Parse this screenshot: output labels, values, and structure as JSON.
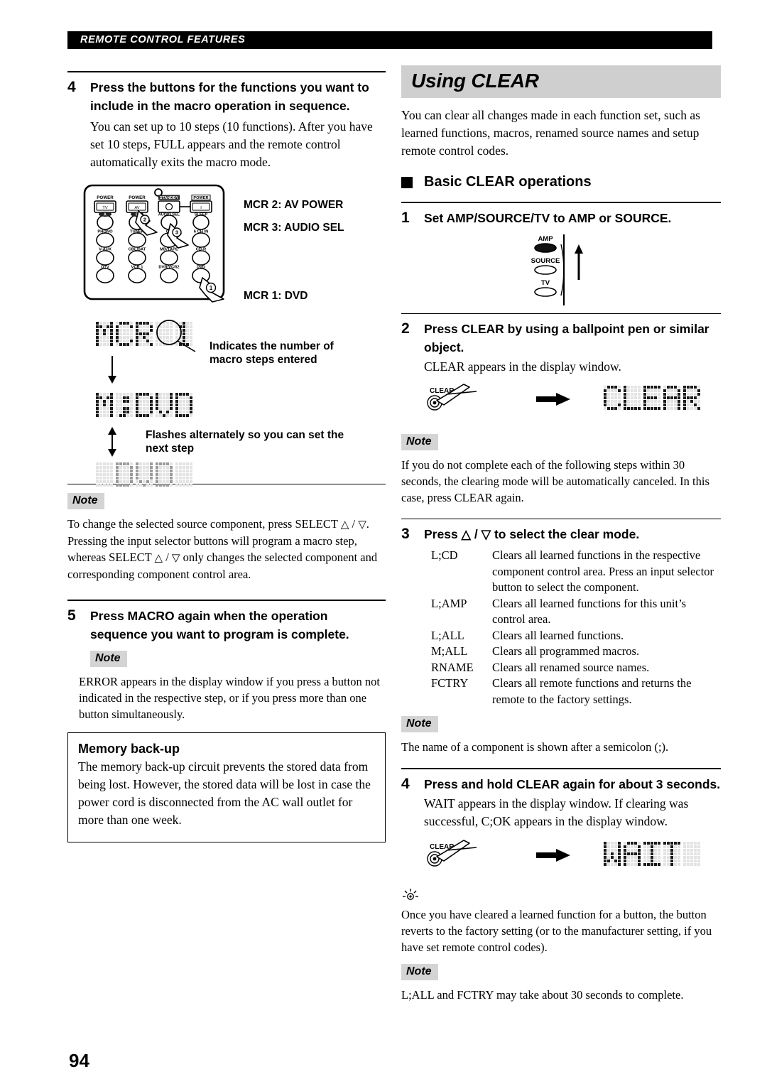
{
  "running_head": "REMOTE CONTROL FEATURES",
  "page_number": "94",
  "left_column": {
    "step4": {
      "number": "4",
      "heading": "Press the buttons for the functions you want to include in the macro operation in sequence.",
      "body": "You can set up to 10 steps (10 functions). After you have set 10 steps, FULL appears and the remote control automatically exits the macro mode."
    },
    "remote_diagram": {
      "buttons": [
        {
          "label": "POWER",
          "sub": "TV"
        },
        {
          "label": "POWER",
          "sub": "AV"
        },
        {
          "label": "STANDBY",
          "sub": "⏻"
        },
        {
          "label": "POWER",
          "sub": "I"
        },
        {
          "label": "A",
          "sub": ""
        },
        {
          "label": "B",
          "sub": ""
        },
        {
          "label": "AUDIO SEL",
          "sub": ""
        },
        {
          "label": "SLEEP",
          "sub": ""
        },
        {
          "label": "PHONO",
          "sub": ""
        },
        {
          "label": "TUNER",
          "sub": ""
        },
        {
          "label": "CD",
          "sub": ""
        },
        {
          "label": "6 CH IN",
          "sub": ""
        },
        {
          "label": "V-AUX",
          "sub": ""
        },
        {
          "label": "CBL/SAT",
          "sub": ""
        },
        {
          "label": "MD/TAPE",
          "sub": ""
        },
        {
          "label": "CD-R",
          "sub": ""
        },
        {
          "label": "DTV",
          "sub": ""
        },
        {
          "label": "VCR 1",
          "sub": ""
        },
        {
          "label": "DVR/VCR2",
          "sub": ""
        },
        {
          "label": "DVD",
          "sub": ""
        }
      ],
      "press_markers": [
        "1",
        "2",
        "3"
      ],
      "mcr_labels": [
        "MCR 2: AV POWER",
        "MCR 3: AUDIO SEL",
        "MCR 1: DVD"
      ]
    },
    "lcd_sequence": {
      "display1": "MCR 1",
      "display1_callout": "Indicates the number of macro steps entered",
      "display2": "M;DVD",
      "display2_callout": "Flashes alternately so you can set the next step",
      "display3": "DVD"
    },
    "note1": {
      "tag": "Note",
      "text_parts": [
        "To change the selected source component, press SELECT ",
        "△",
        " / ",
        "▽",
        ". Pressing the input selector buttons will program a macro step, whereas SELECT ",
        "△",
        " / ",
        "▽",
        " only changes the selected component and corresponding component control area."
      ],
      "text": "To change the selected source component, press SELECT △ / ▽. Pressing the input selector buttons will program a macro step, whereas SELECT △ / ▽ only changes the selected component and corresponding component control area."
    },
    "step5": {
      "number": "5",
      "heading": "Press MACRO again when the operation sequence you want to program is complete."
    },
    "note2": {
      "tag": "Note",
      "text": "ERROR appears in the display window if you press a button not indicated in the respective step, or if you press more than one button simultaneously."
    },
    "memory_box": {
      "title": "Memory back-up",
      "text": "The memory back-up circuit prevents the stored data from being lost. However, the stored data will be lost in case the power cord is disconnected from the AC wall outlet for more than one week."
    }
  },
  "right_column": {
    "banner_title": "Using CLEAR",
    "intro": "You can clear all changes made in each function set, such as learned functions, macros, renamed source names and setup remote control codes.",
    "subsection": "Basic CLEAR operations",
    "step1": {
      "number": "1",
      "heading": "Set AMP/SOURCE/TV to AMP or SOURCE."
    },
    "switch_diagram": {
      "positions": [
        "AMP",
        "SOURCE",
        "TV"
      ],
      "selected": "AMP"
    },
    "step2": {
      "number": "2",
      "heading": "Press CLEAR by using a ballpoint pen or similar object.",
      "body": "CLEAR appears in the display window."
    },
    "clear_diagram_1": {
      "button_label": "CLEAR",
      "display": "CLEAR"
    },
    "note1": {
      "tag": "Note",
      "text": "If you do not complete each of the following steps within 30 seconds, the clearing mode will be automatically canceled. In this case, press CLEAR again."
    },
    "step3": {
      "number": "3",
      "heading_pre": "Press ",
      "heading_up": "△",
      "heading_mid": " / ",
      "heading_down": "▽",
      "heading_post": " to select the clear mode.",
      "modes": [
        {
          "name": "L;CD",
          "desc": "Clears all learned functions in the respective component control area. Press an input selector button to select the component."
        },
        {
          "name": "L;AMP",
          "desc": "Clears all learned functions for this unit’s control area."
        },
        {
          "name": "L;ALL",
          "desc": "Clears all learned functions."
        },
        {
          "name": "M;ALL",
          "desc": "Clears all programmed macros."
        },
        {
          "name": "RNAME",
          "desc": "Clears all renamed source names."
        },
        {
          "name": "FCTRY",
          "desc": "Clears all remote functions and returns the remote to the factory settings."
        }
      ]
    },
    "note2": {
      "tag": "Note",
      "text": "The name of a component is shown after a semicolon (;)."
    },
    "step4": {
      "number": "4",
      "heading": "Press and hold CLEAR again for about 3 seconds.",
      "body": "WAIT appears in the display window. If clearing was successful, C;OK appears in the display window."
    },
    "clear_diagram_2": {
      "button_label": "CLEAR",
      "display": "WAIT"
    },
    "tip": {
      "icon": "tip-bulb-icon",
      "text": "Once you have cleared a learned function for a button, the button reverts to the factory setting (or to the manufacturer setting, if you have set remote control codes)."
    },
    "note3": {
      "tag": "Note",
      "text": "L;ALL and FCTRY may take about 30 seconds to complete."
    }
  },
  "colors": {
    "banner_bg": "#cfcfcf",
    "note_tag_bg": "#d4d4d4",
    "runhead_bg": "#000000",
    "lcd_on": "#1a1a1a",
    "lcd_off": "#e3e3e3"
  }
}
